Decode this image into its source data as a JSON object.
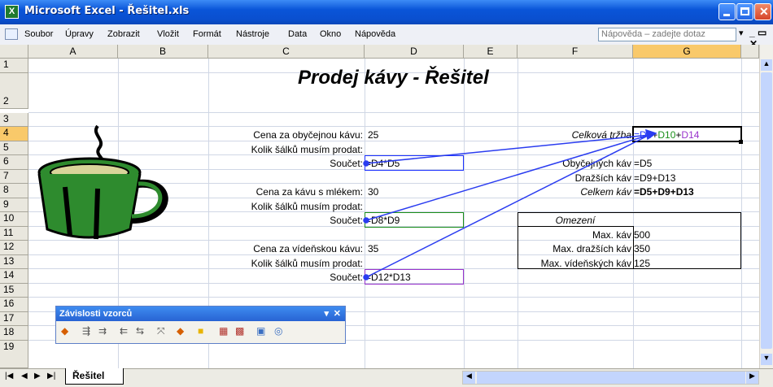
{
  "window": {
    "title": "Microsoft Excel - Řešitel.xls"
  },
  "menu": {
    "items": [
      "Soubor",
      "Úpravy",
      "Zobrazit",
      "Vložit",
      "Formát",
      "Nástroje",
      "Data",
      "Okno",
      "Nápověda"
    ],
    "help_placeholder": "Nápověda – zadejte dotaz"
  },
  "grid": {
    "columns": [
      "A",
      "B",
      "C",
      "D",
      "E",
      "F",
      "G"
    ],
    "rows": [
      "1",
      "2",
      "3",
      "4",
      "5",
      "6",
      "7",
      "8",
      "9",
      "10",
      "11",
      "12",
      "13",
      "14",
      "15",
      "16",
      "17",
      "18",
      "19"
    ],
    "selected_column": "G",
    "selected_row": "4"
  },
  "sheet": {
    "title": "Prodej kávy - Řešitel",
    "c4": "Cena za obyčejnou kávu:",
    "d4": "25",
    "c5": "Kolik šálků musím prodat:",
    "c6": "Součet:",
    "d6": "=D4*D5",
    "c8": "Cena za kávu s mlékem:",
    "d8": "30",
    "c9": "Kolik šálků musím prodat:",
    "c10": "Součet:",
    "d10": "=D8*D9",
    "c12": "Cena za vídeňskou kávu:",
    "d12": "35",
    "c13": "Kolik šálků musím prodat:",
    "c14": "Součet:",
    "d14": "=D12*D13",
    "f4": "Celková tržba",
    "g4_parts": [
      "=D6",
      "+",
      "D10",
      "+",
      "D14"
    ],
    "f6": "Obyčejných káv",
    "g6": "=D5",
    "f7": "Dražších káv",
    "g7": "=D9+D13",
    "f8": "Celkem káv",
    "g8": "=D5+D9+D13",
    "f10": "Omezení",
    "f11": "Max. káv",
    "g11": "500",
    "f12": "Max. dražších káv",
    "g12": "350",
    "f13": "Max. vídeňských káv",
    "g13": "125"
  },
  "colors": {
    "d6": "#1f33ff",
    "d10": "#1a8f1a",
    "d14": "#9933cc",
    "selected_header": "#f9c96a"
  },
  "toolbar_float": {
    "title": "Závislosti vzorců"
  },
  "tabs": [
    "Řešitel"
  ]
}
